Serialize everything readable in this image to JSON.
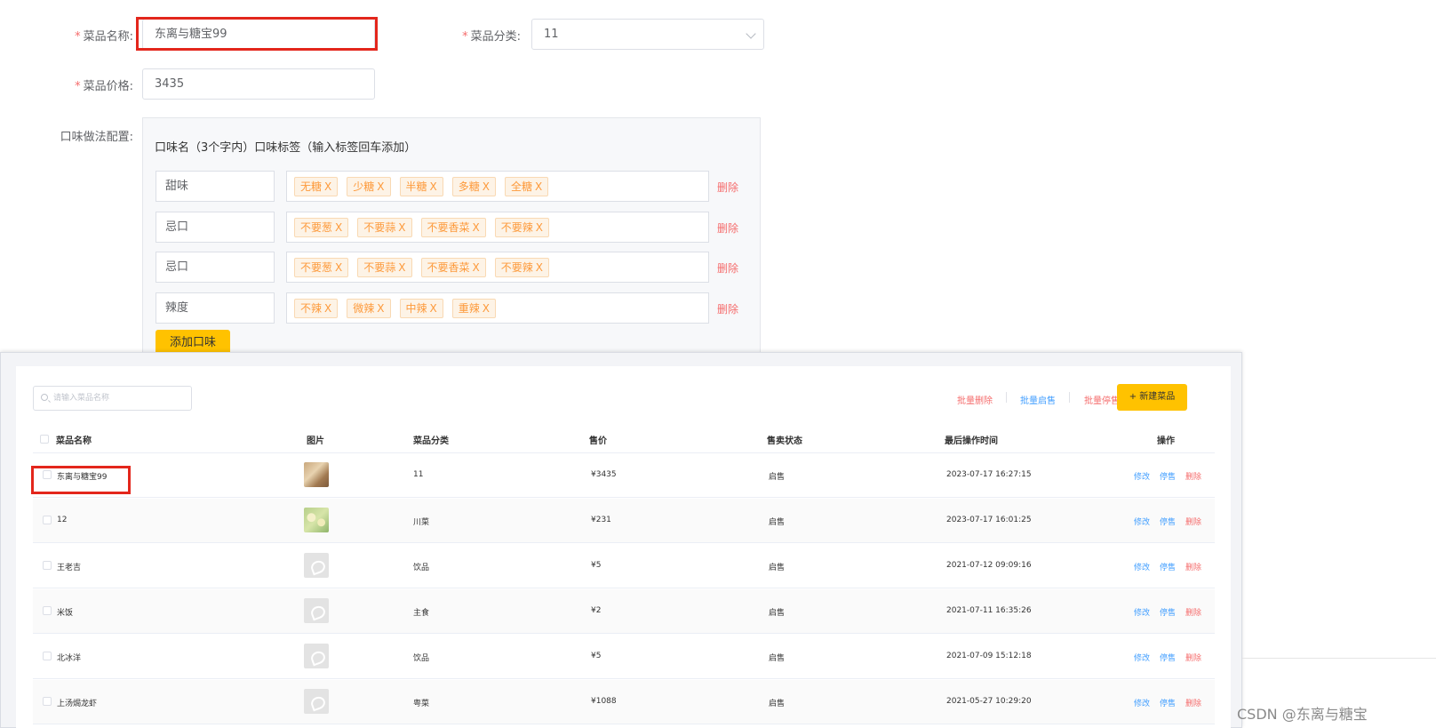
{
  "form": {
    "name_label": "菜品名称:",
    "name_value": "东离与糖宝99",
    "category_label": "菜品分类:",
    "category_value": "11",
    "price_label": "菜品价格:",
    "price_value": "3435",
    "flavor_label": "口味做法配置:",
    "flavor_header": "口味名（3个字内）口味标签（输入标签回车添加）",
    "flavors": [
      {
        "name": "甜味",
        "tags": [
          "无糖",
          "少糖",
          "半糖",
          "多糖",
          "全糖"
        ]
      },
      {
        "name": "忌口",
        "tags": [
          "不要葱",
          "不要蒜",
          "不要香菜",
          "不要辣"
        ]
      },
      {
        "name": "忌口",
        "tags": [
          "不要葱",
          "不要蒜",
          "不要香菜",
          "不要辣"
        ]
      },
      {
        "name": "辣度",
        "tags": [
          "不辣",
          "微辣",
          "中辣",
          "重辣"
        ]
      }
    ],
    "tag_close": "X",
    "delete_label": "删除",
    "add_flavor_label": "添加口味"
  },
  "list": {
    "search_placeholder": "请输入菜品名称",
    "batch_delete": "批量删除",
    "batch_start": "批量启售",
    "batch_stop": "批量停售",
    "new_dish": "+ 新建菜品",
    "columns": [
      "菜品名称",
      "图片",
      "菜品分类",
      "售价",
      "售卖状态",
      "最后操作时间",
      "操作"
    ],
    "rows": [
      {
        "name": "东离与糖宝99",
        "image": "photo1",
        "category": "11",
        "price": "¥3435",
        "status": "启售",
        "time": "2023-07-17 16:27:15"
      },
      {
        "name": "12",
        "image": "photo2",
        "category": "川菜",
        "price": "¥231",
        "status": "启售",
        "time": "2023-07-17 16:01:25"
      },
      {
        "name": "王老吉",
        "image": "ph",
        "category": "饮品",
        "price": "¥5",
        "status": "启售",
        "time": "2021-07-12 09:09:16"
      },
      {
        "name": "米饭",
        "image": "ph",
        "category": "主食",
        "price": "¥2",
        "status": "启售",
        "time": "2021-07-11 16:35:26"
      },
      {
        "name": "北冰洋",
        "image": "ph",
        "category": "饮品",
        "price": "¥5",
        "status": "启售",
        "time": "2021-07-09 15:12:18"
      },
      {
        "name": "上汤焗龙虾",
        "image": "ph",
        "category": "粤菜",
        "price": "¥1088",
        "status": "启售",
        "time": "2021-05-27 10:29:20"
      }
    ],
    "op_edit": "修改",
    "op_stop": "停售",
    "op_delete": "删除"
  },
  "watermark": "CSDN @东离与糖宝",
  "colors": {
    "accent": "#ffc200",
    "danger": "#f56c6c",
    "link": "#419eff",
    "tag_text": "#fd9a3b",
    "highlight": "#e3261c"
  }
}
